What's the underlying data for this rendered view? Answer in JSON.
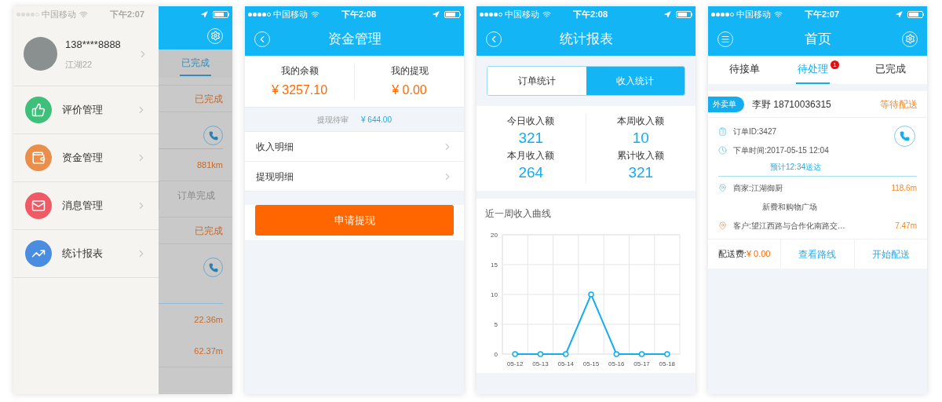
{
  "drawer_screen": {
    "status_bar": {
      "carrier": "中国移动",
      "time": "下午2:07"
    },
    "profile": {
      "phone": "138****8888",
      "name": "江湖22"
    },
    "menu": [
      {
        "kind": "review",
        "label": "评价管理",
        "color": "#3fc07a"
      },
      {
        "kind": "funds",
        "label": "资金管理",
        "color": "#ea8f4b"
      },
      {
        "kind": "messages",
        "label": "消息管理",
        "color": "#ef5a64"
      },
      {
        "kind": "stats",
        "label": "统计报表",
        "color": "#4a8de0"
      }
    ],
    "background": {
      "tab": {
        "label": "已完成",
        "selected": true
      },
      "rows": [
        {
          "kind": "status",
          "text": "已完成"
        },
        {
          "kind": "body",
          "distances": [
            "881km"
          ]
        },
        {
          "kind": "action",
          "text": "订单完成"
        },
        {
          "kind": "status",
          "text": "已完成"
        },
        {
          "kind": "body",
          "distances": [
            "22.36m",
            "62.37m"
          ]
        }
      ]
    }
  },
  "funds_screen": {
    "status_bar": {
      "carrier": "中国移动",
      "time": "下午2:08"
    },
    "title": "资金管理",
    "summary": [
      {
        "label": "我的余额",
        "amount": "¥ 3257.10"
      },
      {
        "label": "我的提现",
        "amount": "¥ 0.00"
      }
    ],
    "pending": {
      "label": "提现待审",
      "amount": "¥ 644.00"
    },
    "menu": [
      "收入明细",
      "提现明细"
    ],
    "button": "申请提现"
  },
  "stats_screen": {
    "status_bar": {
      "carrier": "中国移动",
      "time": "下午2:08"
    },
    "title": "统计报表",
    "segments": [
      {
        "label": "订单统计",
        "selected": false
      },
      {
        "label": "收入统计",
        "selected": true
      }
    ],
    "stats": [
      {
        "label": "今日收入额",
        "value": "321"
      },
      {
        "label": "本周收入额",
        "value": "10"
      },
      {
        "label": "本月收入额",
        "value": "264"
      },
      {
        "label": "累计收入额",
        "value": "321"
      }
    ],
    "chart_title": "近一周收入曲线",
    "chart_data": {
      "type": "line",
      "categories": [
        "05-12",
        "05-13",
        "05-14",
        "05-15",
        "05-16",
        "05-17",
        "05-18"
      ],
      "series": [
        {
          "color": "#13aef0",
          "marker": "circle",
          "values": [
            0,
            0,
            0,
            10,
            0,
            0,
            0
          ]
        }
      ],
      "grid": true,
      "ylim": [
        0,
        20
      ],
      "yticks": [
        0,
        5,
        10,
        15,
        20
      ]
    }
  },
  "home_screen": {
    "status_bar": {
      "carrier": "中国移动",
      "time": "下午2:07"
    },
    "title": "首页",
    "tabs": [
      {
        "label": "待接单",
        "selected": false
      },
      {
        "label": "待处理",
        "selected": true,
        "badge": "1"
      },
      {
        "label": "已完成",
        "selected": false
      }
    ],
    "order": {
      "tag": "外卖单",
      "customer": "李野 18710036315",
      "status": "等待配送",
      "order_id": "订单ID:3427",
      "order_time": "下单时间:2017-05-15 12:04",
      "eta": "预计12:34送达",
      "merchant": "商家:江湖御厨",
      "merchant_distance": "118.6m",
      "merchant_address": "新费和购物广场",
      "customer_address": "客户:望江西路与合作化南路交…",
      "customer_distance": "7.47m",
      "fee_label": "配送费:",
      "fee": "¥ 0.00",
      "actions": [
        "查看路线",
        "开始配送"
      ]
    }
  }
}
